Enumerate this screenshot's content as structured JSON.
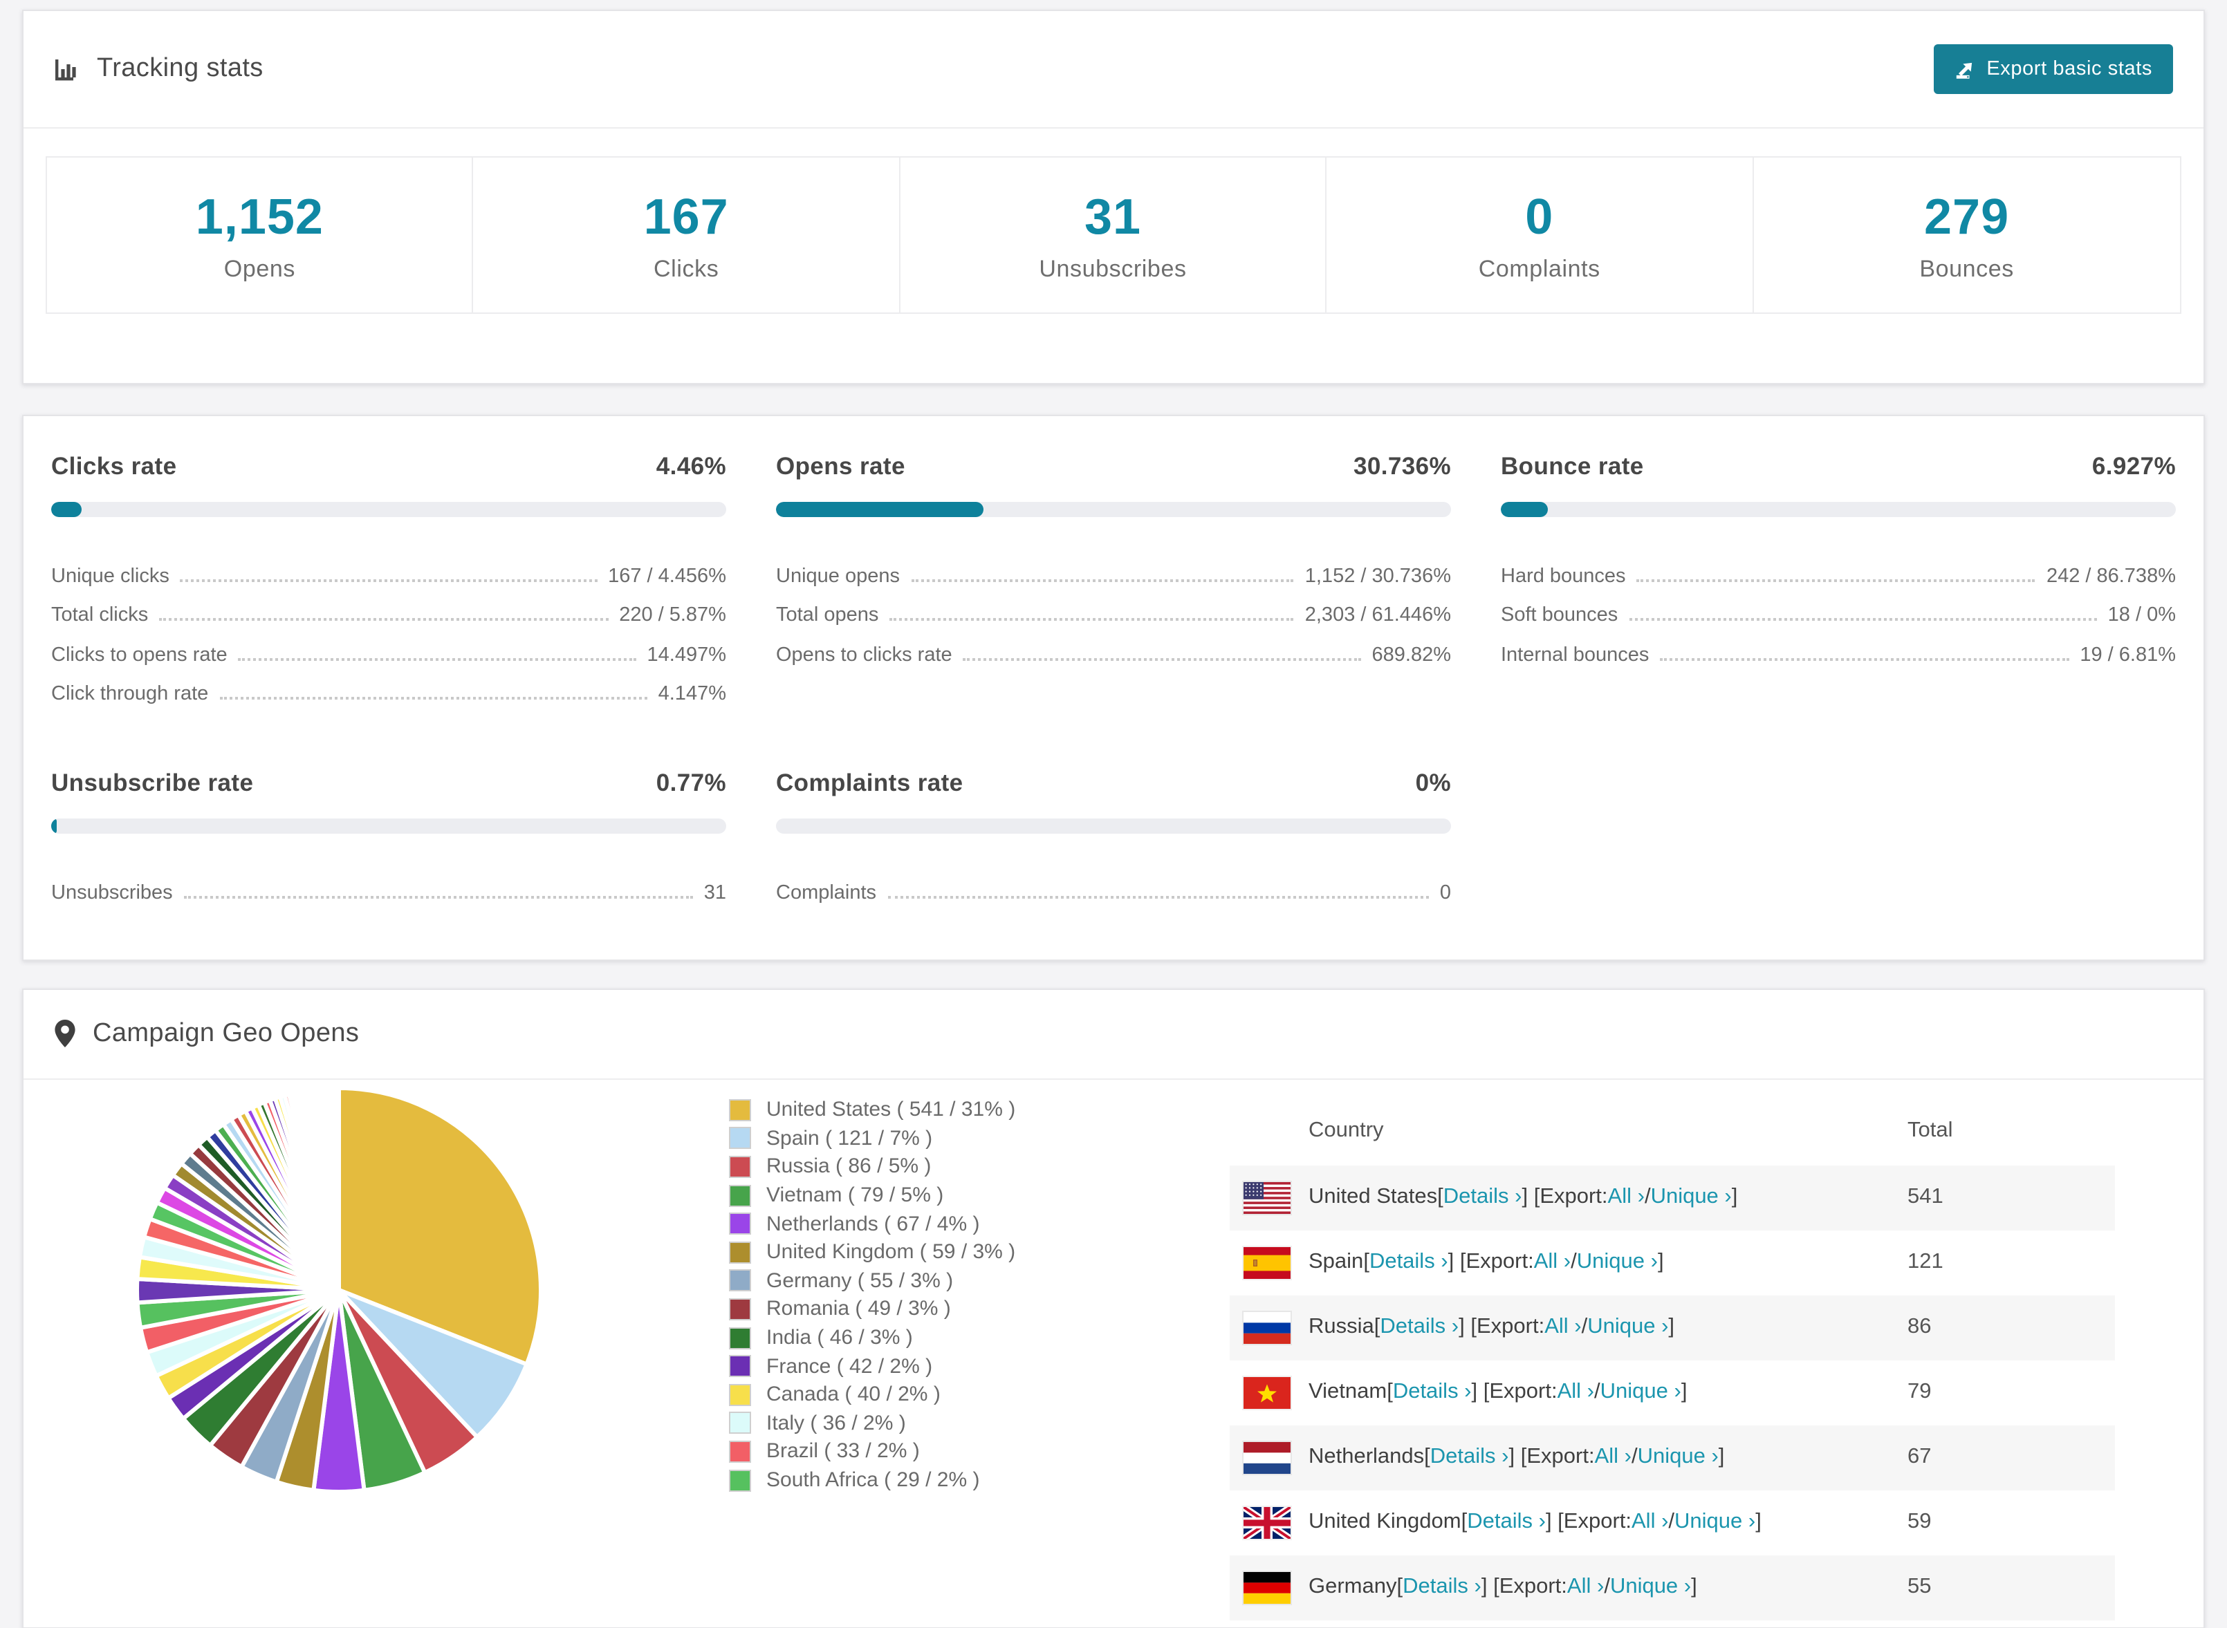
{
  "colors": {
    "accent": "#1088a4",
    "button": "#177f95",
    "bar_fill": "#0e819b",
    "bar_track": "#ecedf1",
    "link": "#1b95ae"
  },
  "tracking": {
    "title": "Tracking stats",
    "export_button": "Export basic stats",
    "stats": [
      {
        "value": "1,152",
        "label": "Opens"
      },
      {
        "value": "167",
        "label": "Clicks"
      },
      {
        "value": "31",
        "label": "Unsubscribes"
      },
      {
        "value": "0",
        "label": "Complaints"
      },
      {
        "value": "279",
        "label": "Bounces"
      }
    ]
  },
  "rates": [
    {
      "title": "Clicks rate",
      "value": "4.46%",
      "percent": 4.46,
      "rows": [
        {
          "label": "Unique clicks",
          "value": "167 / 4.456%"
        },
        {
          "label": "Total clicks",
          "value": "220 / 5.87%"
        },
        {
          "label": "Clicks to opens rate",
          "value": "14.497%"
        },
        {
          "label": "Click through rate",
          "value": "4.147%"
        }
      ]
    },
    {
      "title": "Opens rate",
      "value": "30.736%",
      "percent": 30.736,
      "rows": [
        {
          "label": "Unique opens",
          "value": "1,152 / 30.736%"
        },
        {
          "label": "Total opens",
          "value": "2,303 / 61.446%"
        },
        {
          "label": "Opens to clicks rate",
          "value": "689.82%"
        }
      ]
    },
    {
      "title": "Bounce rate",
      "value": "6.927%",
      "percent": 6.927,
      "rows": [
        {
          "label": "Hard bounces",
          "value": "242 / 86.738%"
        },
        {
          "label": "Soft bounces",
          "value": "18 / 0%"
        },
        {
          "label": "Internal bounces",
          "value": "19 / 6.81%"
        }
      ]
    },
    {
      "title": "Unsubscribe rate",
      "value": "0.77%",
      "percent": 0.77,
      "rows": [
        {
          "label": "Unsubscribes",
          "value": "31"
        }
      ]
    },
    {
      "title": "Complaints rate",
      "value": "0%",
      "percent": 0,
      "rows": [
        {
          "label": "Complaints",
          "value": "0"
        }
      ]
    }
  ],
  "geo": {
    "title": "Campaign Geo Opens",
    "table_headers": {
      "country": "Country",
      "total": "Total"
    },
    "link_labels": {
      "details": "Details",
      "export": "Export:",
      "all": "All",
      "unique": "Unique",
      "chevron": "›"
    },
    "rows": [
      {
        "flag": "us",
        "country": "United States",
        "total": "541"
      },
      {
        "flag": "es",
        "country": "Spain",
        "total": "121"
      },
      {
        "flag": "ru",
        "country": "Russia",
        "total": "86"
      },
      {
        "flag": "vn",
        "country": "Vietnam",
        "total": "79"
      },
      {
        "flag": "nl",
        "country": "Netherlands",
        "total": "67"
      },
      {
        "flag": "gb",
        "country": "United Kingdom",
        "total": "59"
      },
      {
        "flag": "de",
        "country": "Germany",
        "total": "55"
      }
    ]
  },
  "chart_data": {
    "type": "pie",
    "title": "Campaign Geo Opens",
    "legend_position": "right",
    "start_angle_deg": -90,
    "direction": "clockwise",
    "slices": [
      {
        "name": "United States",
        "value": 541,
        "percent": 31,
        "color": "#e4bb3e"
      },
      {
        "name": "Spain",
        "value": 121,
        "percent": 7,
        "color": "#b6d9f2"
      },
      {
        "name": "Russia",
        "value": 86,
        "percent": 5,
        "color": "#cc4b52"
      },
      {
        "name": "Vietnam",
        "value": 79,
        "percent": 5,
        "color": "#47a44b"
      },
      {
        "name": "Netherlands",
        "value": 67,
        "percent": 4,
        "color": "#9a45e8"
      },
      {
        "name": "United Kingdom",
        "value": 59,
        "percent": 3,
        "color": "#ad8e2d"
      },
      {
        "name": "Germany",
        "value": 55,
        "percent": 3,
        "color": "#8fabc7"
      },
      {
        "name": "Romania",
        "value": 49,
        "percent": 3,
        "color": "#9e3a40"
      },
      {
        "name": "India",
        "value": 46,
        "percent": 3,
        "color": "#2f7d32"
      },
      {
        "name": "France",
        "value": 42,
        "percent": 2,
        "color": "#6b2fb3"
      },
      {
        "name": "Canada",
        "value": 40,
        "percent": 2,
        "color": "#f7df4b"
      },
      {
        "name": "Italy",
        "value": 36,
        "percent": 2,
        "color": "#dcfbfa"
      },
      {
        "name": "Brazil",
        "value": 33,
        "percent": 2,
        "color": "#f25f66"
      },
      {
        "name": "South Africa",
        "value": 29,
        "percent": 2,
        "color": "#56c15f"
      }
    ],
    "tail": {
      "note": "many small unlabeled countries fading clockwise",
      "total_percent": 26,
      "count": 50,
      "decay": 0.93,
      "colors": [
        "#6a38b3",
        "#f7e84d",
        "#dffbfb",
        "#f56666",
        "#57c563",
        "#dc48e4",
        "#8a3fc4",
        "#a18a2f",
        "#5e7c8e",
        "#963a3e",
        "#1f5c26",
        "#2f3d9e",
        "#4caf50",
        "#b5d9f2",
        "#cc4b52",
        "#e4bc3f",
        "#9a45e8",
        "#f7df4b",
        "#35762f",
        "#f25f66"
      ]
    }
  }
}
